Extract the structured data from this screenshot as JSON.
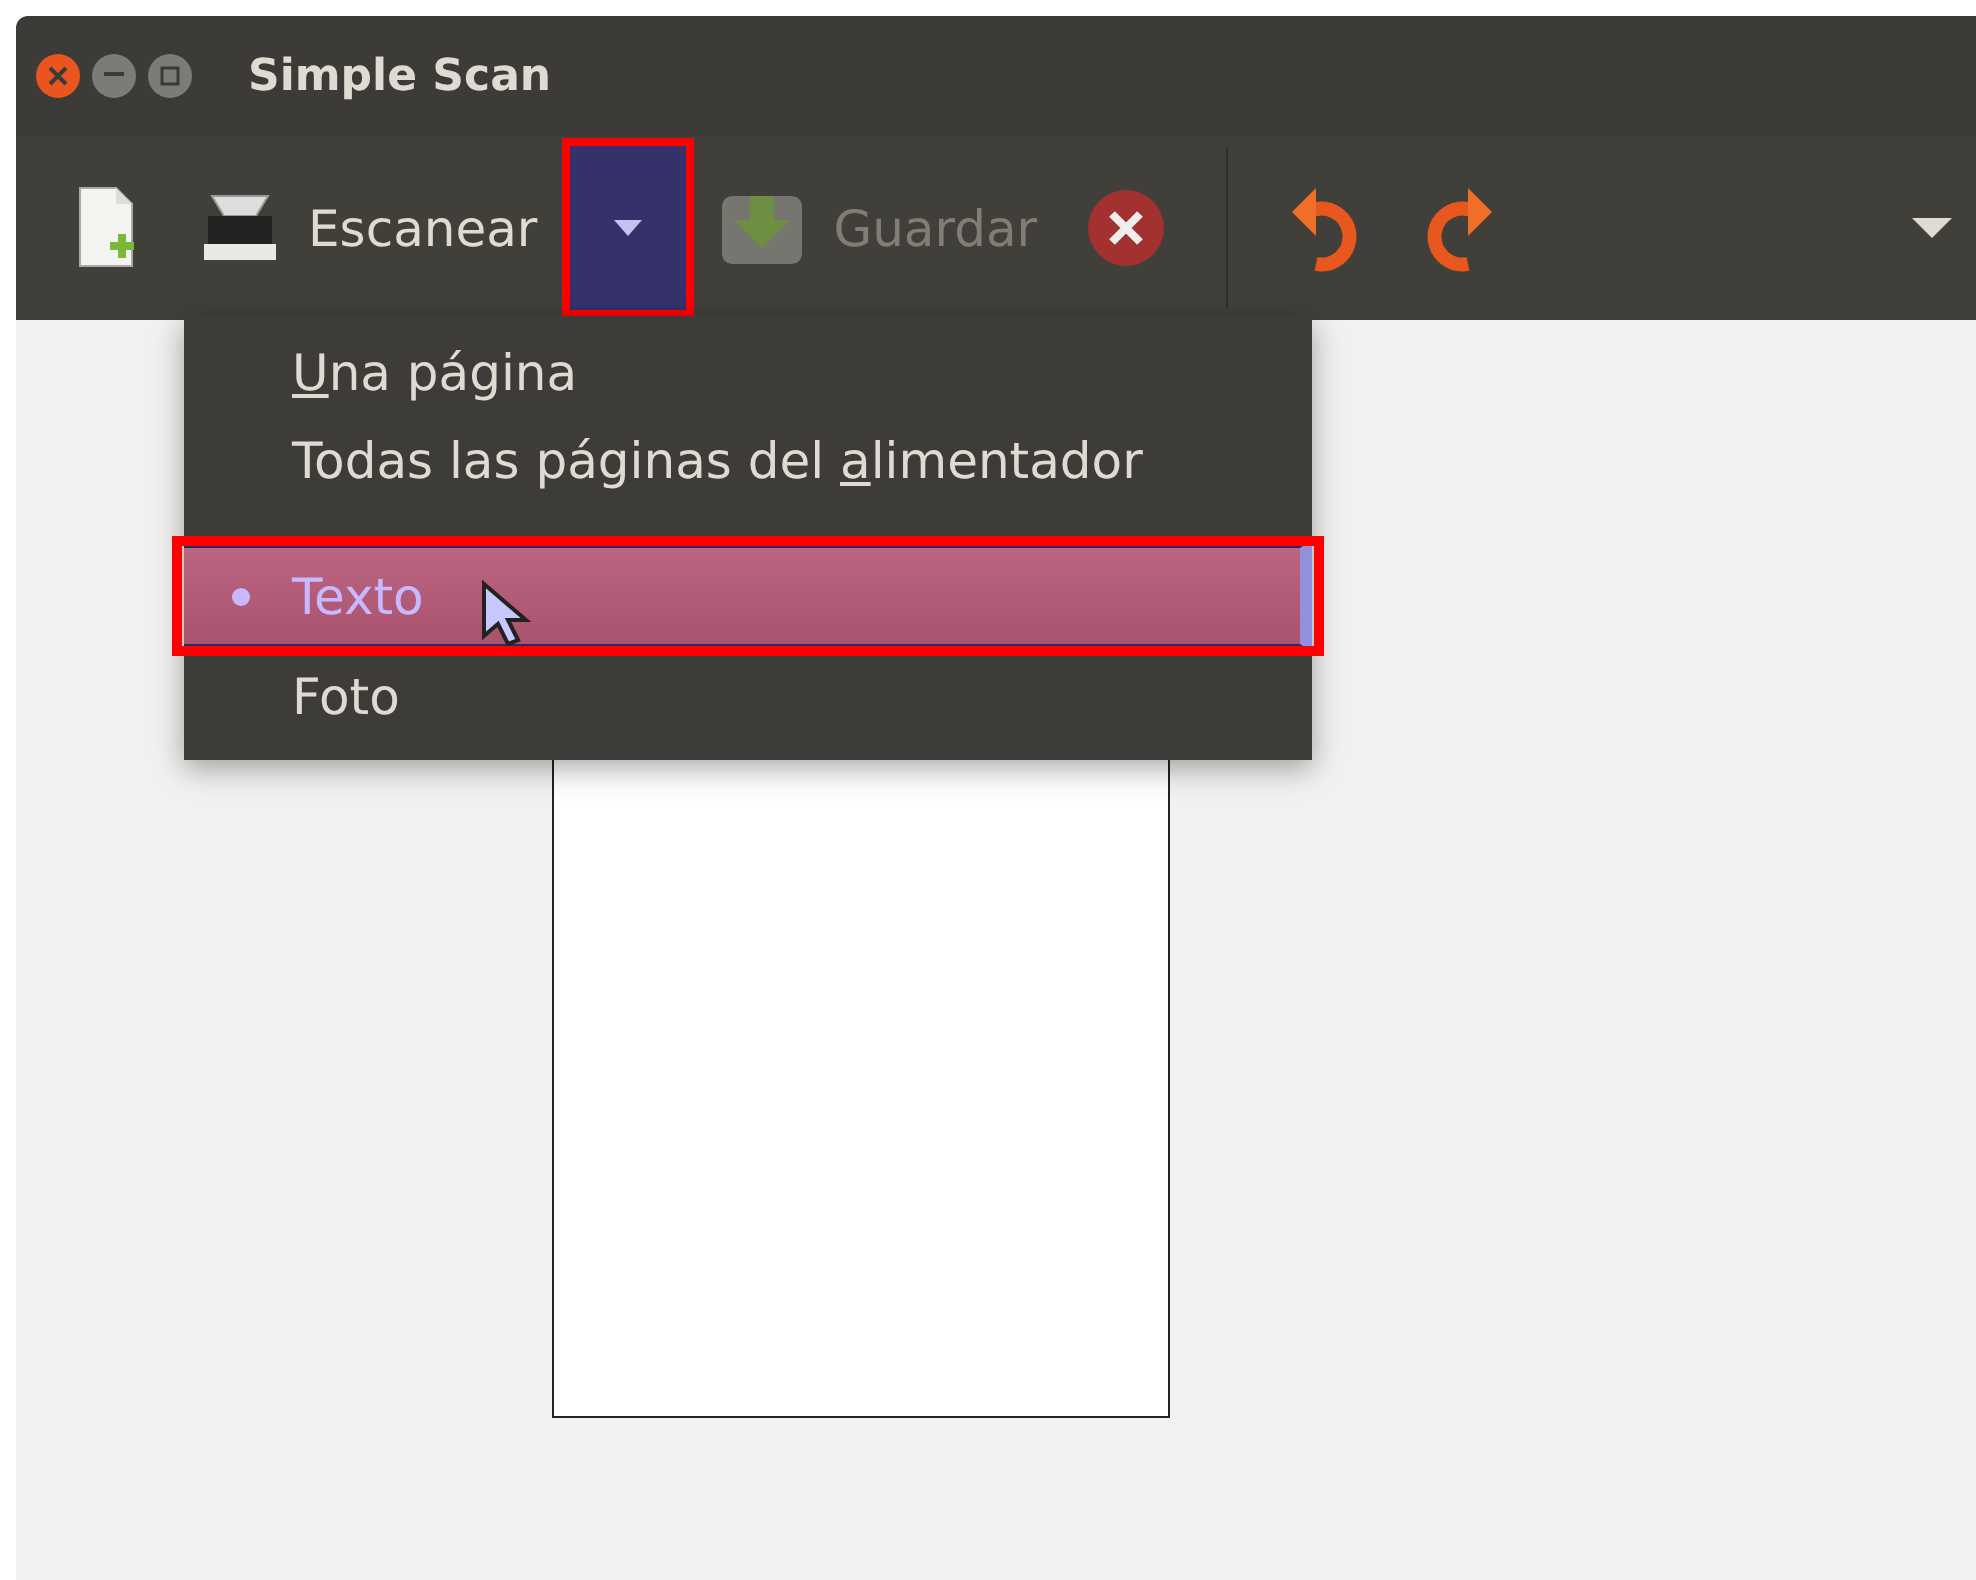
{
  "window": {
    "title": "Simple Scan"
  },
  "toolbar": {
    "scan_label": "Escanear",
    "save_label": "Guardar",
    "save_disabled": true,
    "dropdown_open": true
  },
  "menu": {
    "items": [
      {
        "kind": "action",
        "mnemonic": "U",
        "post": "na página"
      },
      {
        "kind": "action",
        "pre": "Todas las páginas del ",
        "mnemonic": "a",
        "post": "limentador"
      },
      {
        "kind": "separator"
      },
      {
        "kind": "radio",
        "pre": "Texto",
        "selected": true
      },
      {
        "kind": "radio",
        "pre": "Foto",
        "selected": false
      }
    ]
  }
}
